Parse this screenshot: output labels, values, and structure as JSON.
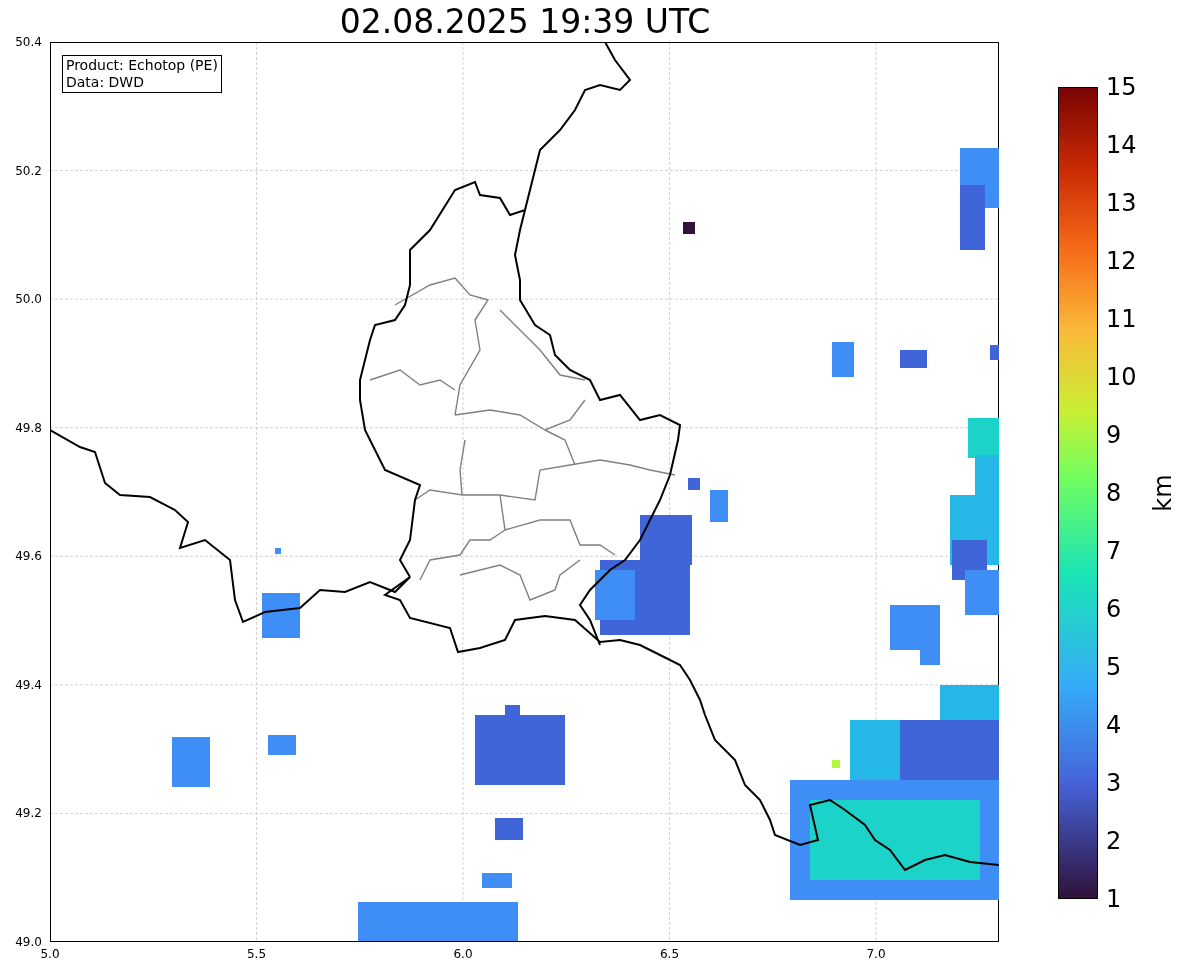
{
  "title": "02.08.2025 19:39 UTC",
  "info_box": {
    "lines": [
      "Product: Echotop (PE)",
      "Data: DWD"
    ]
  },
  "x_axis": {
    "ticks": [
      "5.0",
      "5.5",
      "6.0",
      "6.5",
      "7.0"
    ]
  },
  "y_axis": {
    "ticks": [
      "50.4",
      "50.2",
      "50.0",
      "49.8",
      "49.6",
      "49.4",
      "49.2",
      "49.0"
    ]
  },
  "colorbar": {
    "label": "km",
    "ticks": [
      "15",
      "14",
      "13",
      "12",
      "11",
      "10",
      "9",
      "8",
      "7",
      "6",
      "5",
      "4",
      "3",
      "2",
      "1"
    ]
  }
}
